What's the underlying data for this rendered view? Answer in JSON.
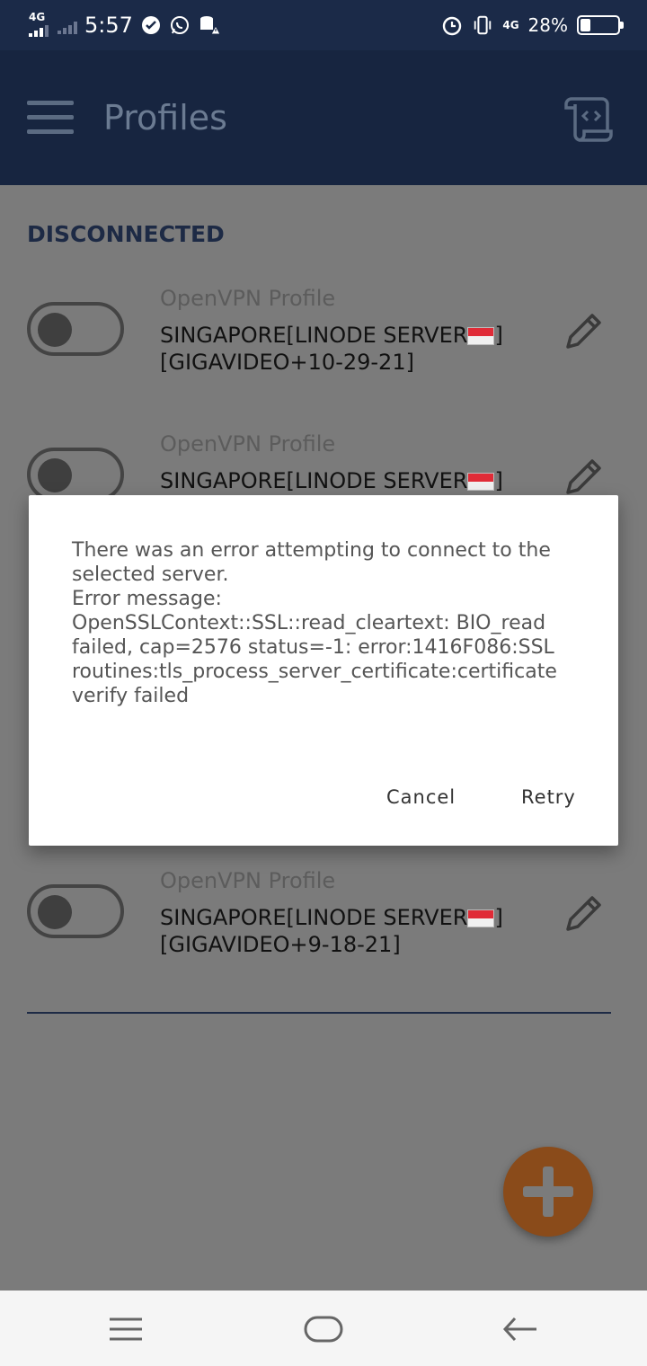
{
  "status_bar": {
    "network_label": "4G",
    "time": "5:57",
    "network_label_right": "4G",
    "battery_text": "28%",
    "battery_level": 0.28,
    "icons": [
      "check-circle-icon",
      "whatsapp-icon",
      "storage-warning-icon",
      "alarm-icon",
      "vibrate-icon"
    ]
  },
  "app_bar": {
    "title": "Profiles",
    "icons": [
      "menu-icon",
      "import-profile-icon"
    ]
  },
  "section": {
    "status_title": "DISCONNECTED"
  },
  "profiles": [
    {
      "type": "OpenVPN Profile",
      "name_line1": "SINGAPORE[LINODE SERVER",
      "name_line1_end": "]",
      "name_line2": "[GIGAVIDEO+10-29-21]",
      "enabled": false
    },
    {
      "type": "OpenVPN Profile",
      "name_line1": "SINGAPORE[LINODE SERVER",
      "name_line1_end": "]",
      "name_line2": "",
      "enabled": false
    },
    {
      "type": "OpenVPN Profile",
      "name_line1": "SINGAPORE[LINODE SERVER",
      "name_line1_end": "]",
      "name_line2": "[GIGAVIDEO+9-18-21]",
      "enabled": false
    }
  ],
  "dialog": {
    "message": "There was an error attempting to connect to the selected server.\nError message: OpenSSLContext::SSL::read_cleartext: BIO_read failed, cap=2576 status=-1: error:1416F086:SSL routines:tls_process_server_certificate:certificate verify failed",
    "cancel_label": "Cancel",
    "retry_label": "Retry"
  },
  "colors": {
    "status_bar_bg": "#1b2a48",
    "app_bar_bg": "#172540",
    "accent": "#1d2a45",
    "fab": "#8a4b1a"
  }
}
